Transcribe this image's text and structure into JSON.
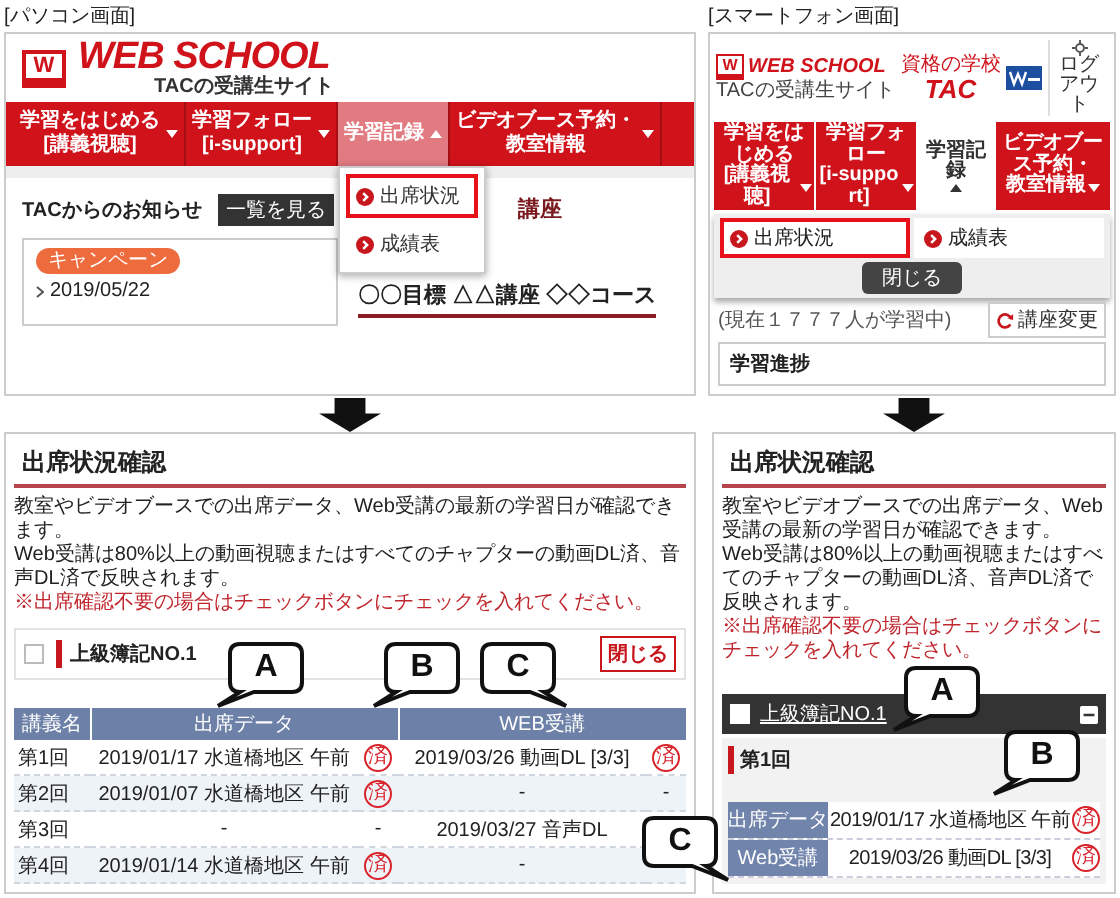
{
  "pc": {
    "caption": "[パソコン画面]",
    "logo": {
      "mark": "W",
      "title": "WEB SCHOOL",
      "subtitle": "TACの受講生サイト"
    },
    "nav": [
      {
        "line1": "学習をはじめる",
        "line2": "[講義視聴]",
        "selected": false,
        "expanded": false
      },
      {
        "line1": "学習フォロー",
        "line2": "[i-support]",
        "selected": false,
        "expanded": false
      },
      {
        "line1": "学習記録",
        "selected": true,
        "expanded": true
      },
      {
        "line1": "ビデオブース予約・",
        "line2": "教室情報",
        "selected": false,
        "expanded": false
      }
    ],
    "dropdown": [
      {
        "label": "出席状況",
        "selected": true
      },
      {
        "label": "成績表",
        "selected": false
      }
    ],
    "news": {
      "title": "TACからのお知らせ",
      "button": "一覧を見る",
      "tag": "キャンペーン",
      "date": "2019/05/22"
    },
    "course": {
      "category": "講座",
      "name": "〇〇目標 △△講座 ◇◇コース"
    }
  },
  "sp": {
    "caption": "[スマートフォン画面]",
    "logo": {
      "mark": "W",
      "title": "WEB SCHOOL",
      "subtitle": "TACの受講生サイト"
    },
    "brand": {
      "tagline": "資格の学校",
      "name": "TAC"
    },
    "logout": "ログアウト",
    "nav": [
      {
        "line1": "学習をはじめる",
        "line2": "[講義視聴]",
        "selected": false,
        "expanded": false
      },
      {
        "line1": "学習フォロー",
        "line2": "[i-support]",
        "selected": false,
        "expanded": false
      },
      {
        "line1": "学習記録",
        "selected": true,
        "expanded": true
      },
      {
        "line1": "ビデオブース予約・",
        "line2": "教室情報",
        "selected": false,
        "expanded": false
      }
    ],
    "submenu": [
      {
        "label": "出席状況",
        "selected": true
      },
      {
        "label": "成績表",
        "selected": false
      }
    ],
    "close": "閉じる",
    "learners": "(現在１７７７人が学習中)",
    "change_course": "講座変更",
    "progress": "学習進捗"
  },
  "pc_result": {
    "title": "出席状況確認",
    "intro": [
      "教室やビデオブースでの出席データ、Web受講の最新の学習日が確認できます。",
      "Web受講は80%以上の動画視聴またはすべてのチャプターの動画DL済、音声DL済で反映されます。"
    ],
    "notice": "※出席確認不要の場合はチェックボタンにチェックを入れてください。",
    "course": {
      "name": "上級簿記NO.1",
      "checked": false,
      "close": "閉じる"
    },
    "columns": [
      "講義名",
      "出席データ",
      "WEB受講"
    ],
    "rows": [
      {
        "lecture": "第1回",
        "attendance": "2019/01/17 水道橋地区 午前",
        "attendance_mark": {
          "text": "済",
          "stamp": true
        },
        "web": "2019/03/26 動画DL [3/3]",
        "web_mark": {
          "text": "済",
          "stamp": true
        }
      },
      {
        "lecture": "第2回",
        "attendance": "2019/01/07 水道橋地区 午前",
        "attendance_mark": {
          "text": "済",
          "stamp": true
        },
        "web": "-",
        "web_mark": {
          "text": "-",
          "stamp": false
        }
      },
      {
        "lecture": "第3回",
        "attendance": "-",
        "attendance_mark": {
          "text": "-",
          "stamp": false
        },
        "web": "2019/03/27 音声DL"
      },
      {
        "lecture": "第4回",
        "attendance": "2019/01/14 水道橋地区 午前",
        "attendance_mark": {
          "text": "済",
          "stamp": true
        },
        "web": "-"
      }
    ],
    "callouts": [
      "A",
      "B",
      "C"
    ]
  },
  "sp_result": {
    "title": "出席状況確認",
    "intro": [
      "教室やビデオブースでの出席データ、Web受講の最新の学習日が確認できます。",
      "Web受講は80%以上の動画視聴またはすべてのチャプターの動画DL済、音声DL済で反映されます。"
    ],
    "notice": "※出席確認不要の場合はチェックボタンにチェックを入れてください。",
    "course": {
      "name": "上級簿記NO.1",
      "checked": false
    },
    "lecture": "第1回",
    "rows": [
      {
        "label": "出席データ",
        "value": "2019/01/17 水道橋地区 午前",
        "mark": {
          "text": "済",
          "stamp": true
        }
      },
      {
        "label": "Web受講",
        "value": "2019/03/26 動画DL [3/3]",
        "mark": {
          "text": "済",
          "stamp": true
        }
      }
    ],
    "callouts": [
      "A",
      "B",
      "C"
    ]
  }
}
